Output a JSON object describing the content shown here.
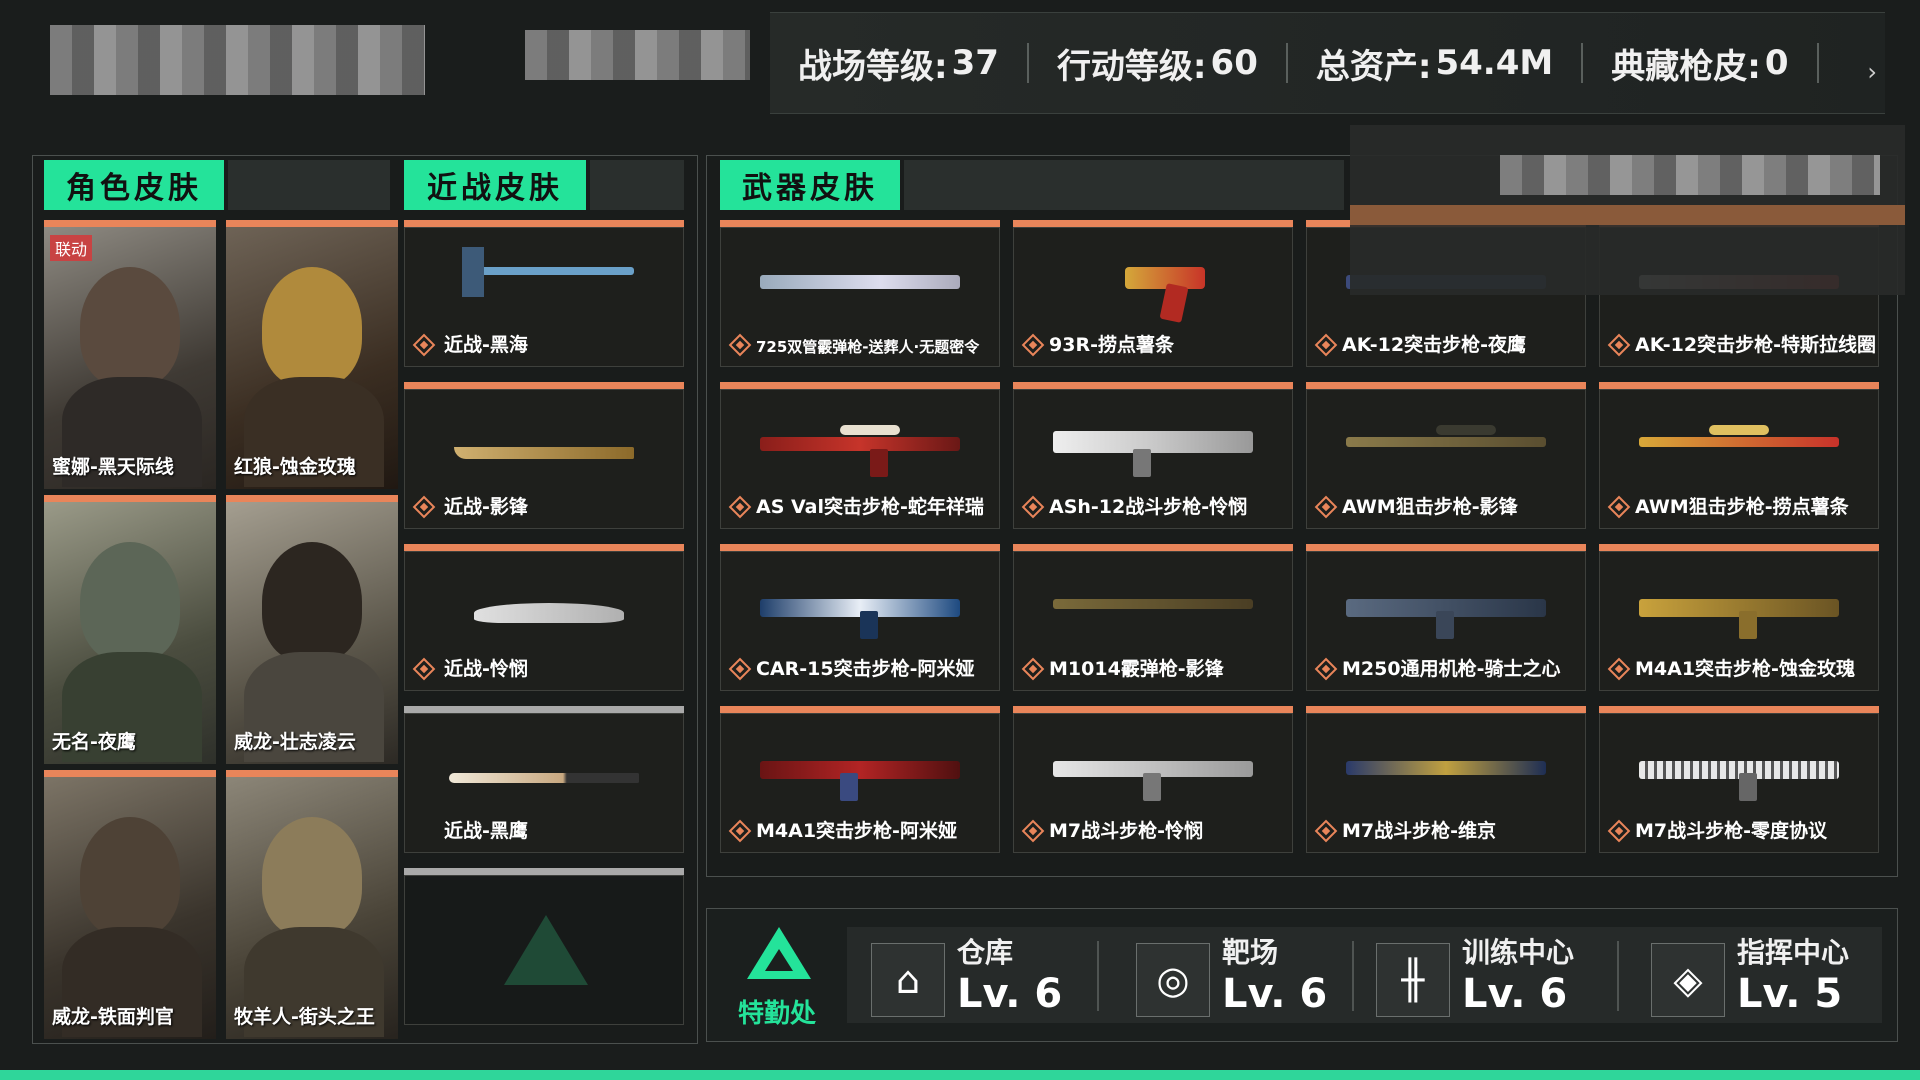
{
  "header": {
    "stats": [
      {
        "label": "战场等级:",
        "value": "37"
      },
      {
        "label": "行动等级: ",
        "value": "60"
      },
      {
        "label": "总资产:",
        "value": "54.4M"
      },
      {
        "label": "典藏枪皮:",
        "value": "0"
      }
    ]
  },
  "sections": {
    "character": "角色皮肤",
    "melee": "近战皮肤",
    "weapon": "武器皮肤"
  },
  "character_skins": [
    {
      "name": "蜜娜-黑天际线",
      "badge": "联动"
    },
    {
      "name": "红狼-蚀金玫瑰"
    },
    {
      "name": "无名-夜鹰"
    },
    {
      "name": "威龙-壮志凌云"
    },
    {
      "name": "威龙-铁面判官"
    },
    {
      "name": "牧羊人-街头之王"
    }
  ],
  "melee_skins": [
    {
      "name": "近战-黑海"
    },
    {
      "name": "近战-影锋"
    },
    {
      "name": "近战-怜悯"
    },
    {
      "name": "近战-黑鹰"
    }
  ],
  "weapon_skins": [
    {
      "name": "725双管霰弹枪-送葬人·无题密令"
    },
    {
      "name": "93R-捞点薯条"
    },
    {
      "name": "AK-12突击步枪-夜鹰"
    },
    {
      "name": "AK-12突击步枪-特斯拉线圈"
    },
    {
      "name": "AS Val突击步枪-蛇年祥瑞"
    },
    {
      "name": "ASh-12战斗步枪-怜悯"
    },
    {
      "name": "AWM狙击步枪-影锋"
    },
    {
      "name": "AWM狙击步枪-捞点薯条"
    },
    {
      "name": "CAR-15突击步枪-阿米娅"
    },
    {
      "name": "M1014霰弹枪-影锋"
    },
    {
      "name": "M250通用机枪-骑士之心"
    },
    {
      "name": "M4A1突击步枪-蚀金玫瑰"
    },
    {
      "name": "M4A1突击步枪-阿米娅"
    },
    {
      "name": "M7战斗步枪-怜悯"
    },
    {
      "name": "M7战斗步枪-维京"
    },
    {
      "name": "M7战斗步枪-零度协议"
    }
  ],
  "logistics": {
    "title": "特勤处",
    "facilities": [
      {
        "name": "仓库",
        "level": "Lv. 6",
        "icon": "warehouse-icon"
      },
      {
        "name": "靶场",
        "level": "Lv. 6",
        "icon": "target-icon"
      },
      {
        "name": "训练中心",
        "level": "Lv. 6",
        "icon": "dumbbell-icon"
      },
      {
        "name": "指挥中心",
        "level": "Lv. 5",
        "icon": "command-icon"
      }
    ]
  },
  "colors": {
    "accent": "#24e39a",
    "card_top": "#e9855a",
    "collab_badge": "#c84343"
  }
}
